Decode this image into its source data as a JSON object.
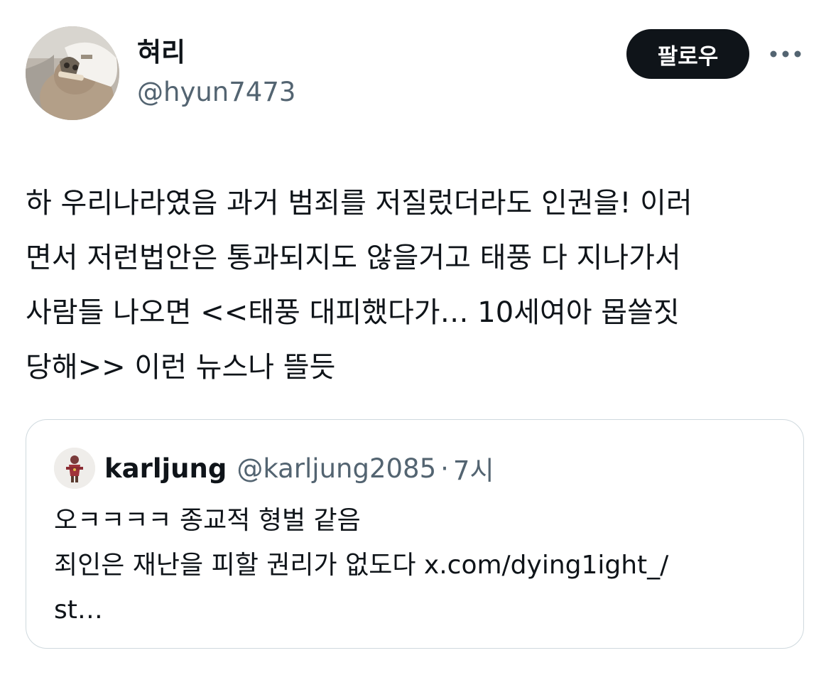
{
  "author": {
    "display_name": "혀리",
    "handle": "@hyun7473",
    "avatar_icon": "profile-photo-cap"
  },
  "actions": {
    "follow_label": "팔로우",
    "more_icon": "more-horizontal-icon"
  },
  "tweet": {
    "lines": [
      "하 우리나라였음 과거 범죄를 저질렀더라도 인권을! 이러",
      "면서 저런법안은 통과되지도 않을거고 태풍 다 지나가서",
      "사람들 나오면 <<태풍 대피했다가… 10세여아 몹쓸짓",
      "당해>> 이런 뉴스나 뜰듯"
    ]
  },
  "quote": {
    "display_name": "karljung",
    "handle": "@karljung2085",
    "separator": "·",
    "time": "7시",
    "lines": [
      "오ㅋㅋㅋㅋ 종교적 형벌 같음",
      "죄인은 재난을 피할 권리가 없도다 x.com/dying1ight_/",
      "st…"
    ]
  },
  "colors": {
    "text_primary": "#0f1419",
    "text_secondary": "#536471",
    "border": "#cfd9de",
    "button_bg": "#0f1419",
    "button_text": "#ffffff"
  }
}
